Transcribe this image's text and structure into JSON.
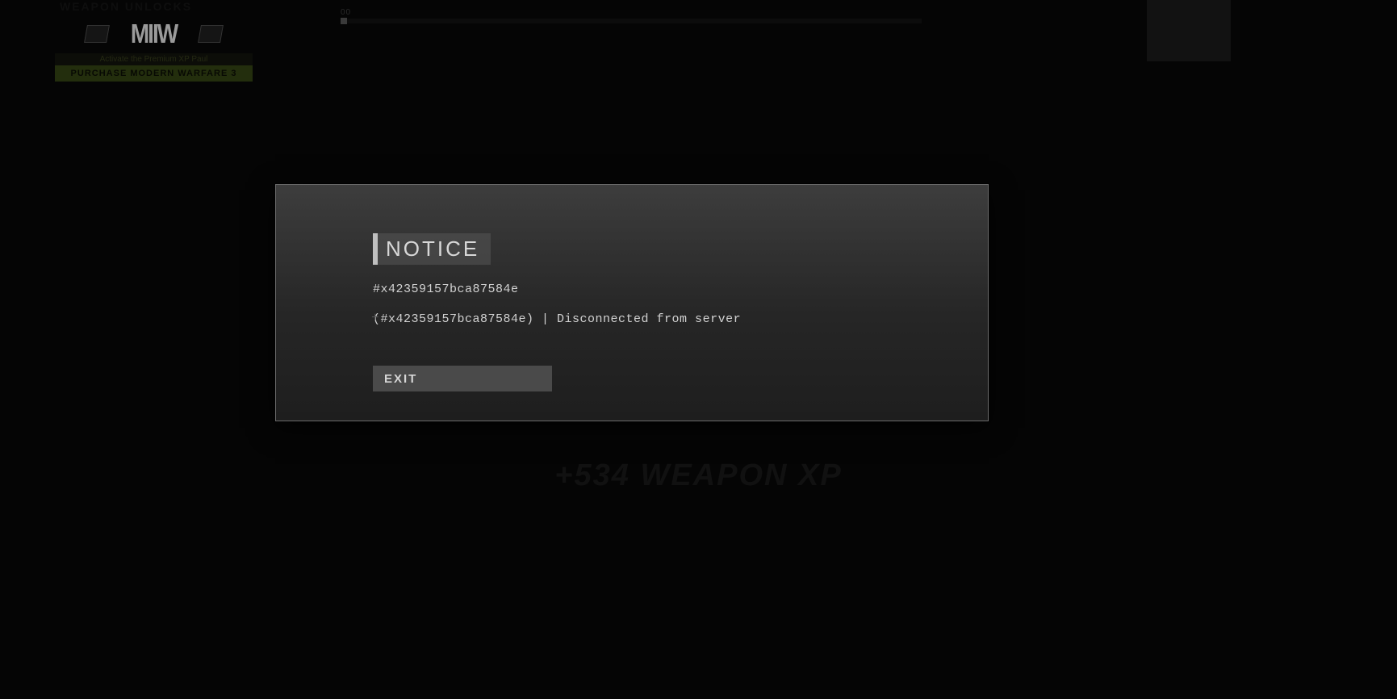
{
  "topleft": {
    "faint_title": "WEAPON UNLOCKS",
    "logo_text": "MIIW",
    "promo_line": "Activate the Premium XP Paul",
    "purchase_label": "PURCHASE MODERN WARFARE 3"
  },
  "progress": {
    "label": "00"
  },
  "background": {
    "xp_text": "+534 WEAPON XP"
  },
  "modal": {
    "title": "NOTICE",
    "code": "#x42359157bca87584e",
    "message": "(#x42359157bca87584e) | Disconnected from server",
    "exit_label": "EXIT"
  }
}
